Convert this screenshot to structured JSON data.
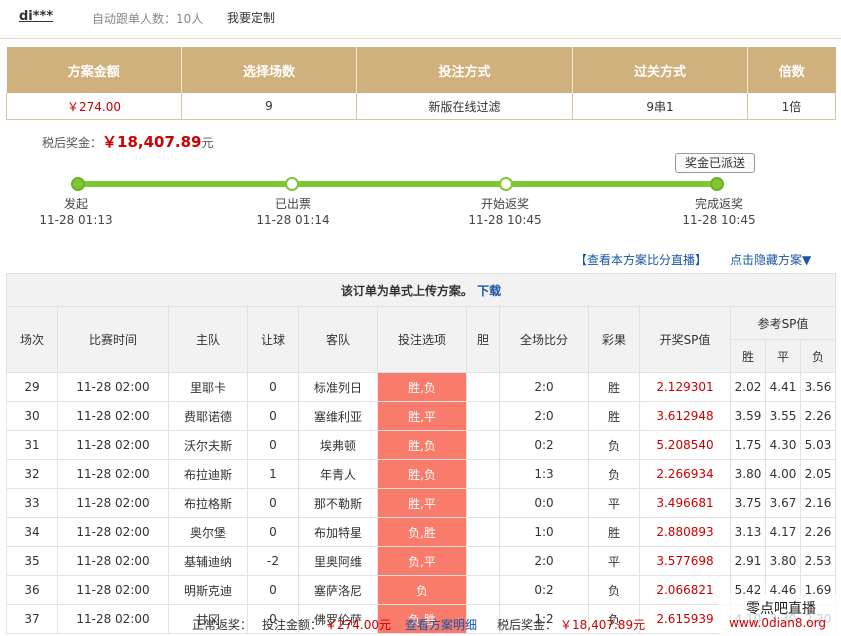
{
  "topbar": {
    "user": "di***",
    "follow_label": "自动跟单人数：10人",
    "custom": "我要定制"
  },
  "summary": {
    "headers": [
      "方案金额",
      "选择场数",
      "投注方式",
      "过关方式",
      "倍数"
    ],
    "values": [
      "￥274.00",
      "9",
      "新版在线过滤",
      "9串1",
      "1倍"
    ]
  },
  "prize": {
    "label": "税后奖金：",
    "value": "￥18,407.89",
    "unit": "元"
  },
  "sent_button": "奖金已派送",
  "steps": [
    {
      "label": "发起",
      "time": "11-28 01:13"
    },
    {
      "label": "已出票",
      "time": "11-28 01:14"
    },
    {
      "label": "开始返奖",
      "time": "11-28 10:45"
    },
    {
      "label": "完成返奖",
      "time": "11-28 10:45"
    }
  ],
  "links": {
    "live": "【查看本方案比分直播】",
    "hide": "点击隐藏方案▼"
  },
  "upload": {
    "text": "该订单为单式上传方案。",
    "download": "下载"
  },
  "detail": {
    "headers": [
      "场次",
      "比赛时间",
      "主队",
      "让球",
      "客队",
      "投注选项",
      "胆",
      "全场比分",
      "彩果",
      "开奖SP值"
    ],
    "sp_header": "参考SP值",
    "sp_sub": [
      "胜",
      "平",
      "负"
    ],
    "rows": [
      [
        "29",
        "11-28 02:00",
        "里耶卡",
        "0",
        "标准列日",
        "胜,负",
        "",
        "2:0",
        "胜",
        "2.129301",
        "2.02",
        "4.41",
        "3.56"
      ],
      [
        "30",
        "11-28 02:00",
        "费耶诺德",
        "0",
        "塞维利亚",
        "胜,平",
        "",
        "2:0",
        "胜",
        "3.612948",
        "3.59",
        "3.55",
        "2.26"
      ],
      [
        "31",
        "11-28 02:00",
        "沃尔夫斯",
        "0",
        "埃弗顿",
        "胜,负",
        "",
        "0:2",
        "负",
        "5.208540",
        "1.75",
        "4.30",
        "5.03"
      ],
      [
        "32",
        "11-28 02:00",
        "布拉迪斯",
        "1",
        "年青人",
        "胜,负",
        "",
        "1:3",
        "负",
        "2.266934",
        "3.80",
        "4.00",
        "2.05"
      ],
      [
        "33",
        "11-28 02:00",
        "布拉格斯",
        "0",
        "那不勒斯",
        "胜,平",
        "",
        "0:0",
        "平",
        "3.496681",
        "3.75",
        "3.67",
        "2.16"
      ],
      [
        "34",
        "11-28 02:00",
        "奥尔堡",
        "0",
        "布加特星",
        "负,胜",
        "",
        "1:0",
        "胜",
        "2.880893",
        "3.13",
        "4.17",
        "2.26"
      ],
      [
        "35",
        "11-28 02:00",
        "基辅迪纳",
        "-2",
        "里奥阿维",
        "负,平",
        "",
        "2:0",
        "平",
        "3.577698",
        "2.91",
        "3.80",
        "2.53"
      ],
      [
        "36",
        "11-28 02:00",
        "明斯克迪",
        "0",
        "塞萨洛尼",
        "负",
        "",
        "0:2",
        "负",
        "2.066821",
        "5.42",
        "4.46",
        "1.69"
      ],
      [
        "37",
        "11-28 02:00",
        "甘冈",
        "0",
        "佛罗伦萨",
        "负,胜",
        "",
        "1:2",
        "负",
        "2.615939",
        "4.10",
        "3.30",
        "2.20"
      ]
    ]
  },
  "footer": {
    "status": "正常返奖：",
    "bet_label": "投注金额：",
    "bet_value": "￥274.00元",
    "detail_link": "查看方案明细",
    "prize_label": "税后奖金：",
    "prize_value": "￥18,407.89元"
  },
  "watermark": {
    "line1": "零点吧直播",
    "line2": "www.0dian8.org"
  }
}
